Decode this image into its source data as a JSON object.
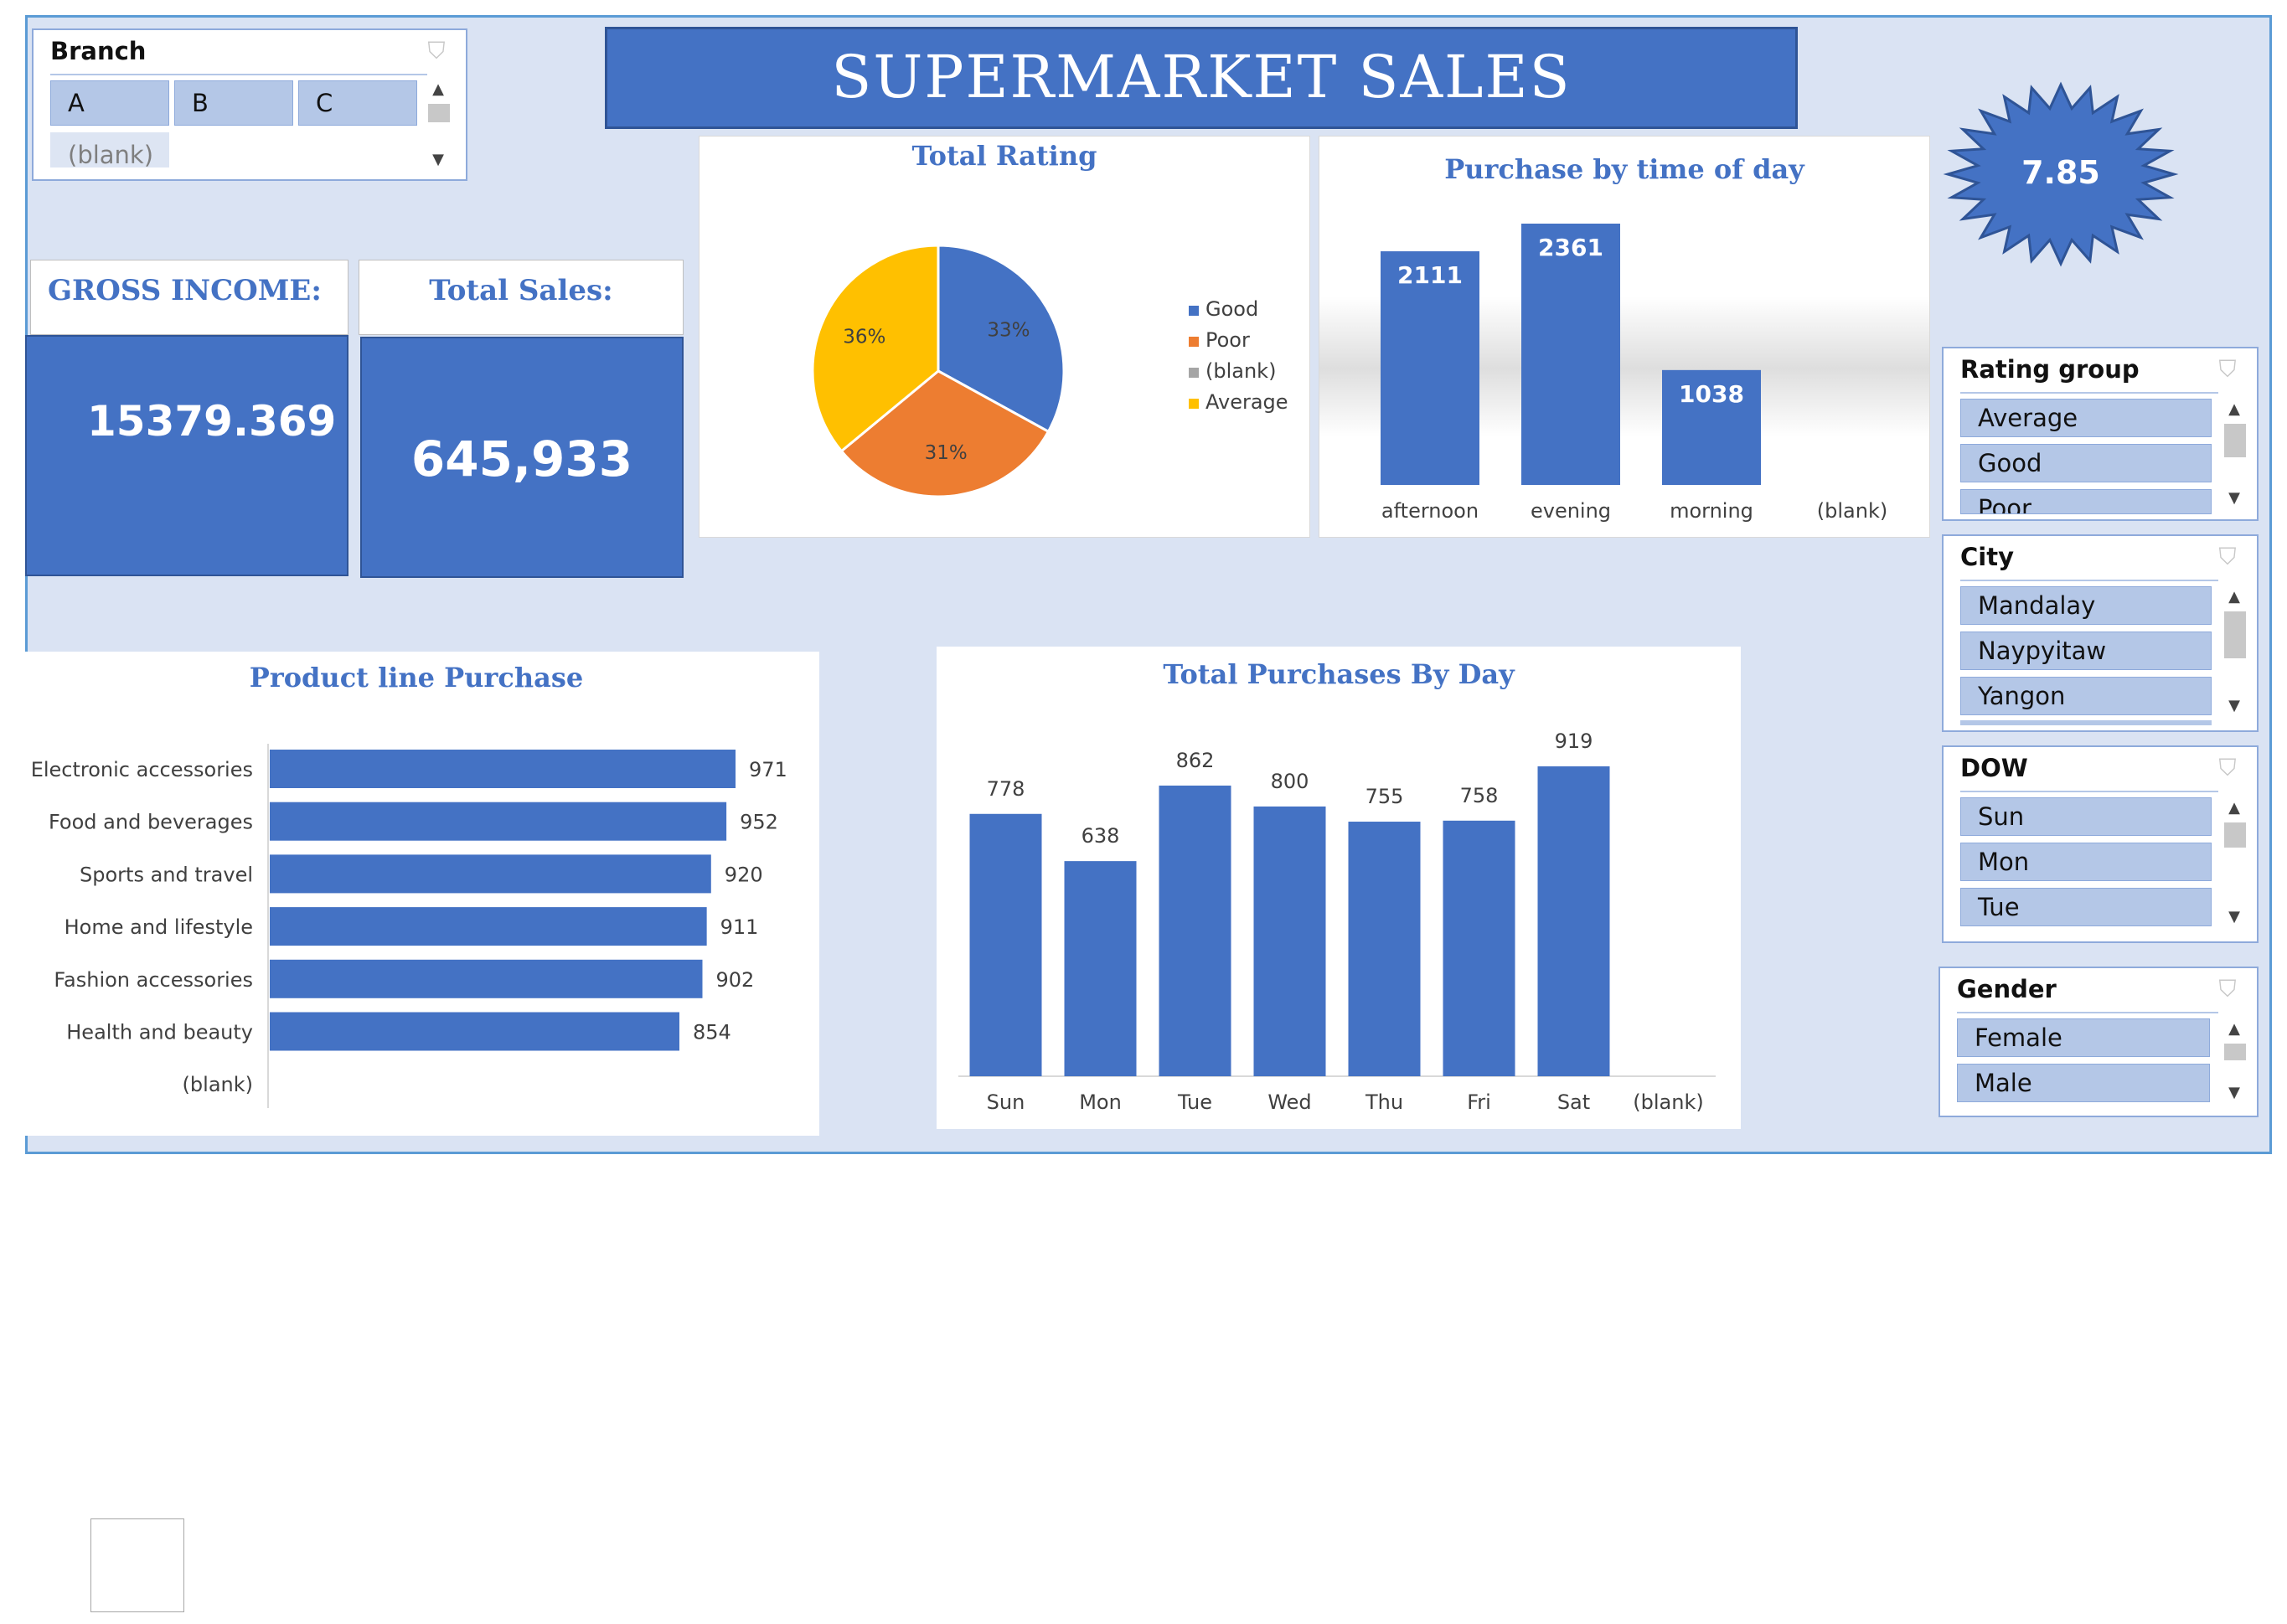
{
  "title": "SUPERMARKET SALES",
  "slicers": {
    "branch": {
      "title": "Branch",
      "items": [
        "A",
        "B",
        "C",
        "(blank)"
      ]
    },
    "rating_group": {
      "title": "Rating group",
      "items": [
        "Average",
        "Good",
        "Poor"
      ]
    },
    "city": {
      "title": "City",
      "items": [
        "Mandalay",
        "Naypyitaw",
        "Yangon"
      ]
    },
    "dow": {
      "title": "DOW",
      "items": [
        "Sun",
        "Mon",
        "Tue"
      ]
    },
    "gender": {
      "title": "Gender",
      "items": [
        "Female",
        "Male"
      ]
    }
  },
  "kpis": {
    "gross_income_label": "GROSS INCOME:",
    "gross_income_value": "15379.369",
    "total_sales_label": "Total Sales:",
    "total_sales_value": "645,933",
    "rating_badge": "7.85"
  },
  "colors": {
    "accent": "#4472c4",
    "poor": "#ed7d31",
    "blank": "#a5a5a5",
    "average": "#ffc000",
    "background": "#dae3f3"
  },
  "chart_data": [
    {
      "type": "pie",
      "title": "Total Rating",
      "slices": [
        {
          "name": "Good",
          "value": 33,
          "label": "33%",
          "color": "#4472c4"
        },
        {
          "name": "Poor",
          "value": 31,
          "label": "31%",
          "color": "#ed7d31"
        },
        {
          "name": "(blank)",
          "value": 0,
          "label": "",
          "color": "#a5a5a5"
        },
        {
          "name": "Average",
          "value": 36,
          "label": "36%",
          "color": "#ffc000"
        }
      ],
      "legend": [
        "Good",
        "Poor",
        "(blank)",
        "Average"
      ],
      "legend_position": "right"
    },
    {
      "type": "bar",
      "title": "Purchase by time of day",
      "categories": [
        "afternoon",
        "evening",
        "morning",
        "(blank)"
      ],
      "values": [
        2111,
        2361,
        1038,
        0
      ],
      "labels": [
        "2111",
        "2361",
        "1038",
        "0"
      ]
    },
    {
      "type": "bar",
      "orientation": "horizontal",
      "title": "Product line Purchase",
      "categories": [
        "Electronic accessories",
        "Food and beverages",
        "Sports and travel",
        "Home and lifestyle",
        "Fashion accessories",
        "Health and beauty",
        "(blank)"
      ],
      "values": [
        971,
        952,
        920,
        911,
        902,
        854,
        0
      ],
      "labels": [
        "971",
        "952",
        "920",
        "911",
        "902",
        "854",
        ""
      ]
    },
    {
      "type": "bar",
      "title": "Total Purchases By Day",
      "categories": [
        "Sun",
        "Mon",
        "Tue",
        "Wed",
        "Thu",
        "Fri",
        "Sat",
        "(blank)"
      ],
      "values": [
        778,
        638,
        862,
        800,
        755,
        758,
        919,
        0
      ],
      "labels": [
        "778",
        "638",
        "862",
        "800",
        "755",
        "758",
        "919",
        ""
      ]
    }
  ]
}
